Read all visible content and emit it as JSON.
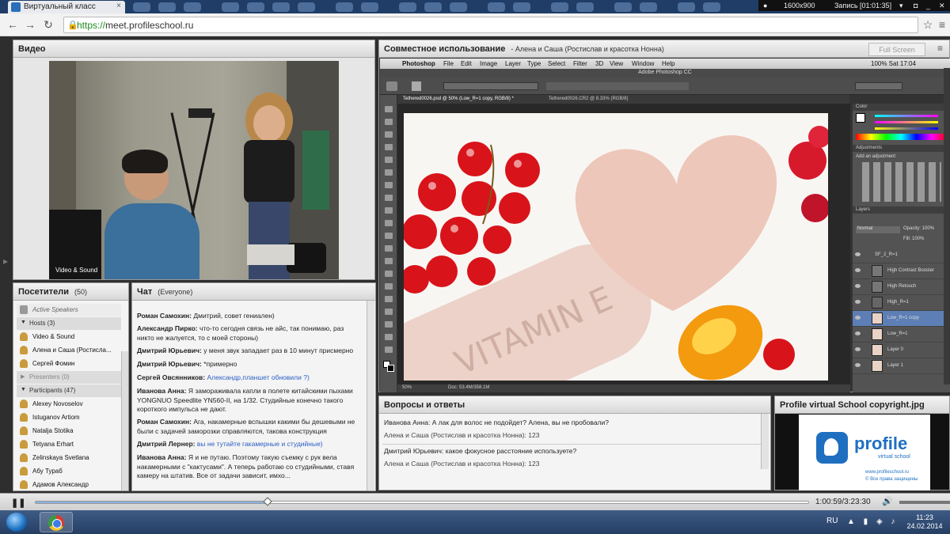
{
  "browser": {
    "tab_title": "Виртуальный класс",
    "url_scheme": "https://",
    "url_host": "meet.profileschool.ru",
    "tab_close": "×"
  },
  "recorder": {
    "resolution": "1600x900",
    "status": "Запись [01:01:35]"
  },
  "video_pod": {
    "title": "Видео",
    "caption": "Video & Sound"
  },
  "attendees": {
    "title": "Посетители",
    "count": "(50)",
    "active_speakers": "Active Speakers",
    "hosts_header": "Hosts (3)",
    "hosts": [
      "Video & Sound",
      "Алена и Саша (Ростисла...",
      "Сергей Фомин"
    ],
    "presenters_header": "Presenters (0)",
    "participants_header": "Participants (47)",
    "participants": [
      "Alexey Novoselov",
      "Istuganov Artiom",
      "Natalja Stotika",
      "Tetyana Erhart",
      "Zelinskaya Svetlana",
      "Абу Тураб",
      "Адамов Александр"
    ]
  },
  "chat": {
    "title": "Чат",
    "scope": "(Everyone)",
    "messages": [
      {
        "author": "Роман Самохин:",
        "text": " Дмитрий, совет гениален)"
      },
      {
        "author": "Александр Пирко:",
        "text": " что-то сегодня связь не айс, так понимаю, раз никто не жалуется, то с моей стороны)"
      },
      {
        "author": "Дмитрий Юрьевич:",
        "text": " у меня звук западает раз в 10 минут присмерно"
      },
      {
        "author": "Дмитрий Юрьевич:",
        "text": " *примерно"
      },
      {
        "author": "Сергей Овсянников:",
        "text": " Александр,планшет обновили ?)"
      },
      {
        "author": "Иванова Анна:",
        "text": " Я замораживала капли в полете китайскими пыхами YONGNUO Speedlite YN560-II, на 1/32. Студийные конечно такого короткого импульса не дают."
      },
      {
        "author": "Роман Самохин:",
        "text": " Ага, накамерные вспышки какими бы дешевыми не были с задачей заморозки справляются, такова конструкция"
      },
      {
        "author": "Дмитрий Лернер:",
        "text": " вы не тутайте гакамерные и студийные)"
      },
      {
        "author": "Иванова Анна:",
        "text": " Я и не путаю. Поэтому такую съемку с рук вела накамерными с \"кактусами\". А теперь работаю со студийными, ставя камеру на штатив. Все от задачи зависит, имхо..."
      }
    ]
  },
  "share_pod": {
    "title": "Совместное использование",
    "presenter": "- Алена и Саша (Ростислав и красотка Нонна)",
    "fullscreen": "Full Screen"
  },
  "photoshop": {
    "menu": [
      "Photoshop",
      "File",
      "Edit",
      "Image",
      "Layer",
      "Type",
      "Select",
      "Filter",
      "3D",
      "View",
      "Window",
      "Help"
    ],
    "menu_right": "100%  Sat 17:04",
    "window_title": "Adobe Photoshop CC",
    "doc_tab_1": "Tethered0026.psd @ 50% (Low_R=1 copy, RGB/8) *",
    "doc_tab_2": "Tethered0026.CR2 @ 8.33% (RGB/8)",
    "canvas_text": "VITAMIN E",
    "zoom": "50%",
    "doc_size": "Doc: 53.4M/358.1M",
    "panel_color": "Color",
    "panel_adjustments": "Adjustments",
    "add_adjustment": "Add an adjustment",
    "panel_layers": "Layers",
    "blend_mode": "Normal",
    "opacity": "Opacity: 100%",
    "fill": "Fill: 100%",
    "layers": [
      "SF_2_R=1",
      "High Contrast Booster",
      "High Retouch",
      "High_R=1",
      "Low_R=1 copy",
      "Low_R=1",
      "Layer 0",
      "Layer 1"
    ]
  },
  "qa": {
    "title": "Вопросы и ответы",
    "items": [
      {
        "q": "Иванова Анна: А лак для волос не подойдет? Алена, вы не пробовали?",
        "a": "Алена и Саша (Ростислав и красотка Нонна): 123"
      },
      {
        "q": "Дмитрий Юрьевич: какое фокусное расстояние используете?",
        "a": "Алена и Саша (Ростислав и красотка Нонна): 123"
      }
    ]
  },
  "copyright_pod": {
    "title": "Profile virtual School copyright.jpg",
    "logo_word": "profile",
    "logo_sub": "virtual school",
    "site": "www.profileschool.ru",
    "rights": "© Все права защищены"
  },
  "playback": {
    "time": "1:00:59/3:23:30",
    "progress": 0.3
  },
  "taskbar": {
    "lang": "RU",
    "time": "11:23",
    "date": "24.02.2014"
  },
  "colors": {
    "accent_blue": "#2a6fb8",
    "chat_link": "#2b5ec5"
  }
}
